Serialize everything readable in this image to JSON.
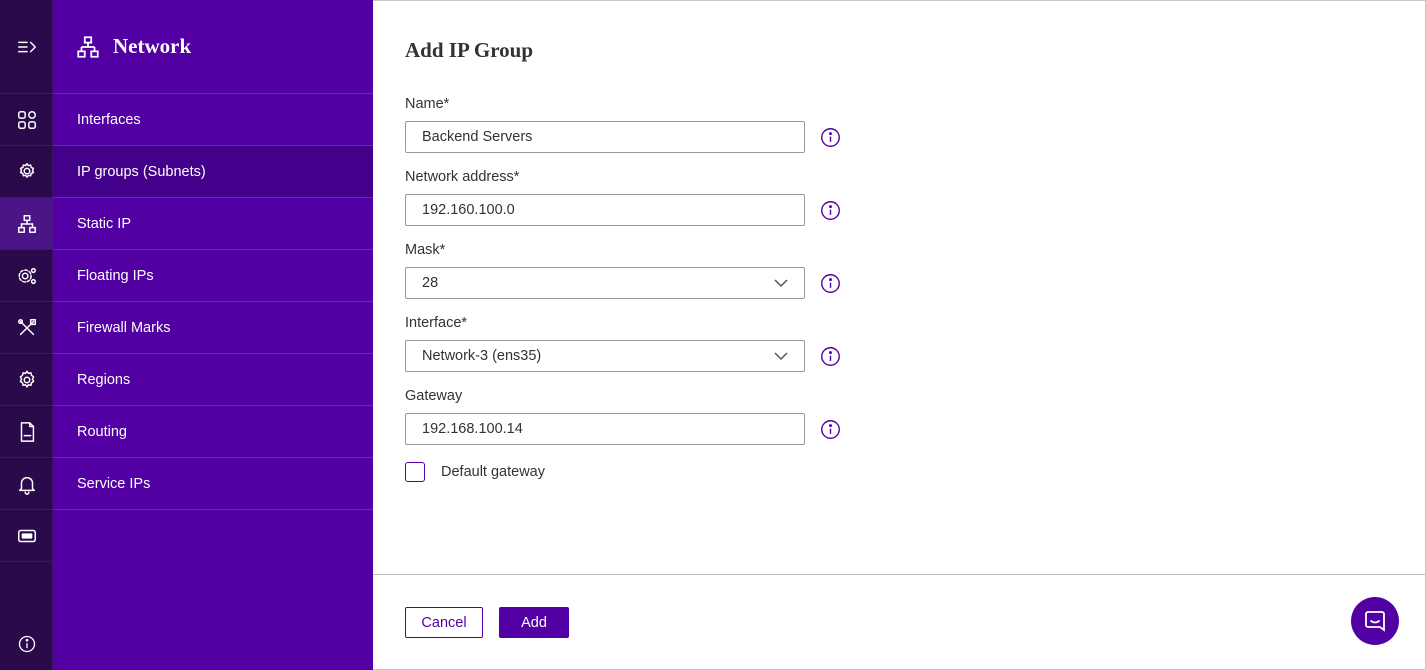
{
  "sidebar": {
    "title": "Network",
    "items": [
      {
        "label": "Interfaces"
      },
      {
        "label": "IP groups (Subnets)"
      },
      {
        "label": "Static IP"
      },
      {
        "label": "Floating IPs"
      },
      {
        "label": "Firewall Marks"
      },
      {
        "label": "Regions"
      },
      {
        "label": "Routing"
      },
      {
        "label": "Service IPs"
      }
    ]
  },
  "rail": {
    "icons": [
      "menu-expand-icon",
      "dashboard-icon",
      "location-gear-icon",
      "network-icon",
      "multi-gear-icon",
      "tools-icon",
      "gear-icon",
      "log-file-icon",
      "bell-icon",
      "ticket-icon",
      "info-icon"
    ]
  },
  "form": {
    "title": "Add IP Group",
    "name": {
      "label": "Name*",
      "value": "Backend Servers"
    },
    "network_address": {
      "label": "Network address*",
      "value": "192.160.100.0"
    },
    "mask": {
      "label": "Mask*",
      "value": "28"
    },
    "interface": {
      "label": "Interface*",
      "value": "Network-3 (ens35)"
    },
    "gateway": {
      "label": "Gateway",
      "value": "192.168.100.14"
    },
    "default_gateway": {
      "label": "Default gateway",
      "checked": false
    }
  },
  "actions": {
    "cancel_label": "Cancel",
    "add_label": "Add"
  },
  "colors": {
    "brand": "#5200a3",
    "rail": "#2a0a4a",
    "active_item": "#43008a"
  }
}
